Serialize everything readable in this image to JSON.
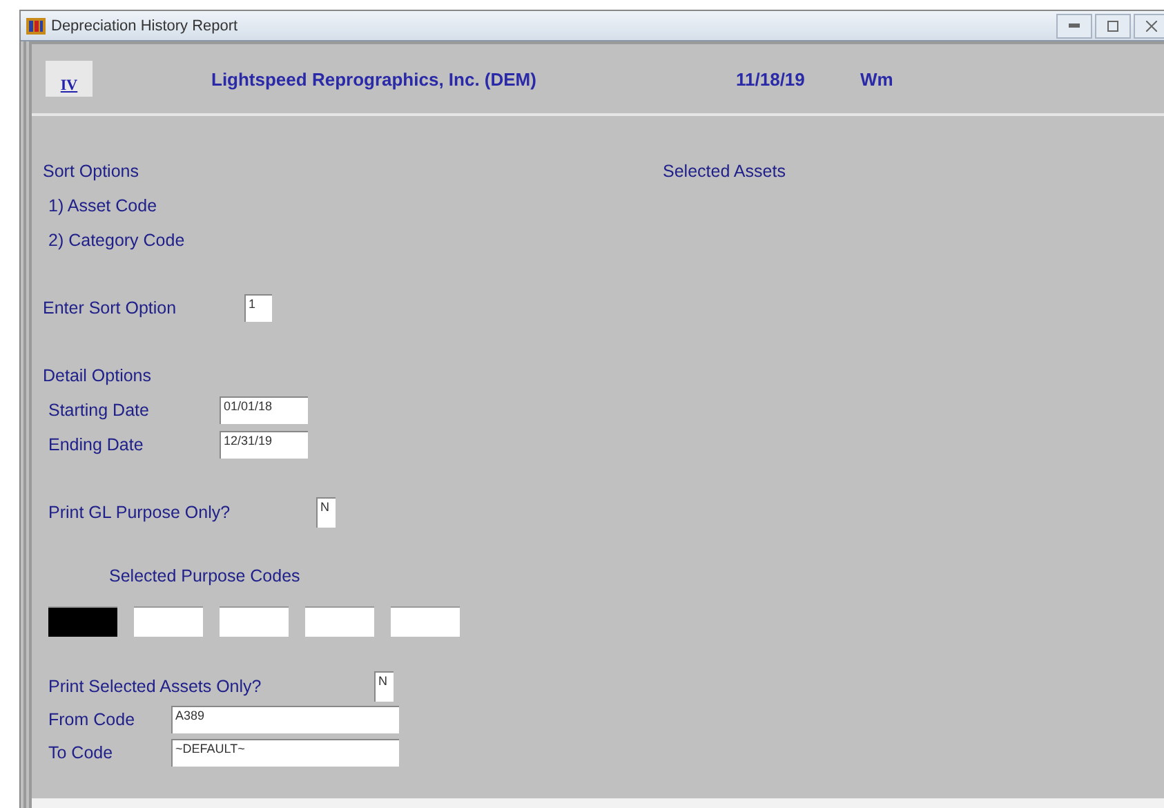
{
  "window": {
    "title": "Depreciation History Report"
  },
  "header": {
    "logo_text": "IV",
    "company": "Lightspeed Reprographics, Inc. (DEM)",
    "date": "11/18/19",
    "user": "Wm"
  },
  "sort_options": {
    "heading": "Sort Options",
    "items": [
      "1) Asset Code",
      "2) Category Code"
    ]
  },
  "sort_field": {
    "label": "Enter Sort Option",
    "value": "1"
  },
  "detail_options": {
    "heading": "Detail Options",
    "fields": [
      {
        "label": "Starting Date",
        "value": "01/01/18"
      },
      {
        "label": "Ending Date",
        "value": "12/31/19"
      }
    ]
  },
  "gl_purpose": {
    "label": "Print GL Purpose Only?",
    "value": "N"
  },
  "purpose_codes": {
    "heading": "Selected Purpose Codes",
    "codes": [
      {
        "selected": true
      },
      {
        "selected": false
      },
      {
        "selected": false
      },
      {
        "selected": false
      },
      {
        "selected": false
      }
    ]
  },
  "selected_assets_only": {
    "label": "Print Selected Assets Only?",
    "value": "N"
  },
  "code_range": [
    {
      "label": "From Code",
      "value": "A389"
    },
    {
      "label": "To Code",
      "value": "~DEFAULT~"
    }
  ],
  "selected_assets": {
    "heading": "Selected Assets"
  }
}
